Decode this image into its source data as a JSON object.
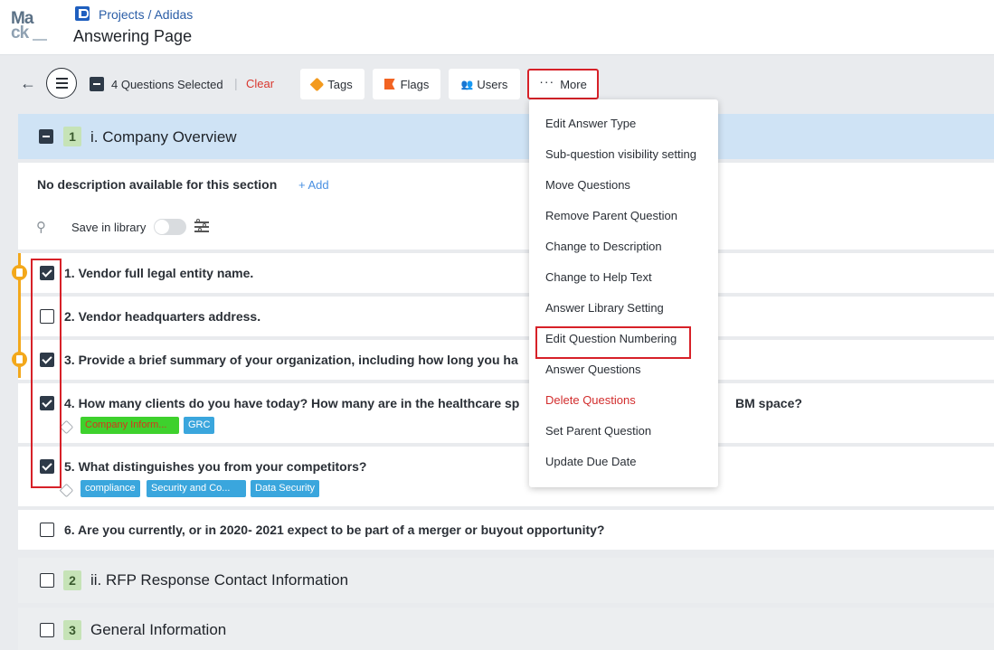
{
  "header": {
    "logo_line1": "Ma",
    "logo_line2": "ck",
    "breadcrumb": "Projects / Adidas",
    "title": "Answering Page"
  },
  "toolbar": {
    "selected_text": "4 Questions Selected",
    "separator": "|",
    "clear_label": "Clear",
    "tags_label": "Tags",
    "flags_label": "Flags",
    "users_label": "Users",
    "more_label": "More"
  },
  "section1": {
    "number": "1",
    "title": "i. Company Overview",
    "description": "No description available for this section",
    "add_label": "+ Add",
    "save_library_label": "Save in library"
  },
  "questions": [
    {
      "text": "1. Vendor full legal entity name.",
      "checked": true
    },
    {
      "text": "2. Vendor headquarters address.",
      "checked": false
    },
    {
      "text": "3. Provide a brief summary of your organization, including how long you ha",
      "checked": true
    },
    {
      "text": "4. How many clients do you have today? How many are in the healthcare sp",
      "text_tail": "BM space?",
      "checked": true,
      "tags": [
        "Company Inform...",
        "GRC"
      ]
    },
    {
      "text": "5. What distinguishes you from your competitors?",
      "checked": true,
      "tags": [
        "compliance",
        "Security and Co...",
        "Data Security"
      ]
    },
    {
      "text": "6. Are you currently, or in 2020- 2021 expect to be part of a merger or buyout opportunity?",
      "checked": false
    }
  ],
  "section2": {
    "number": "2",
    "title": "ii. RFP Response Contact Information"
  },
  "section3": {
    "number": "3",
    "title": "General Information"
  },
  "more_menu": {
    "items": [
      "Edit Answer Type",
      "Sub-question visibility setting",
      "Move Questions",
      "Remove Parent Question",
      "Change to Description",
      "Change to Help Text",
      "Answer Library Setting",
      "Edit Question Numbering",
      "Answer Questions",
      "Delete Questions",
      "Set Parent Question",
      "Update Due Date"
    ]
  },
  "colors": {
    "accent_blue": "#2b5ea7",
    "danger_red": "#d22d2d",
    "highlight_red": "#d72128",
    "flag_orange": "#f3a81b",
    "section_blue": "#cfe3f5",
    "badge_green": "#c6e3b7"
  }
}
